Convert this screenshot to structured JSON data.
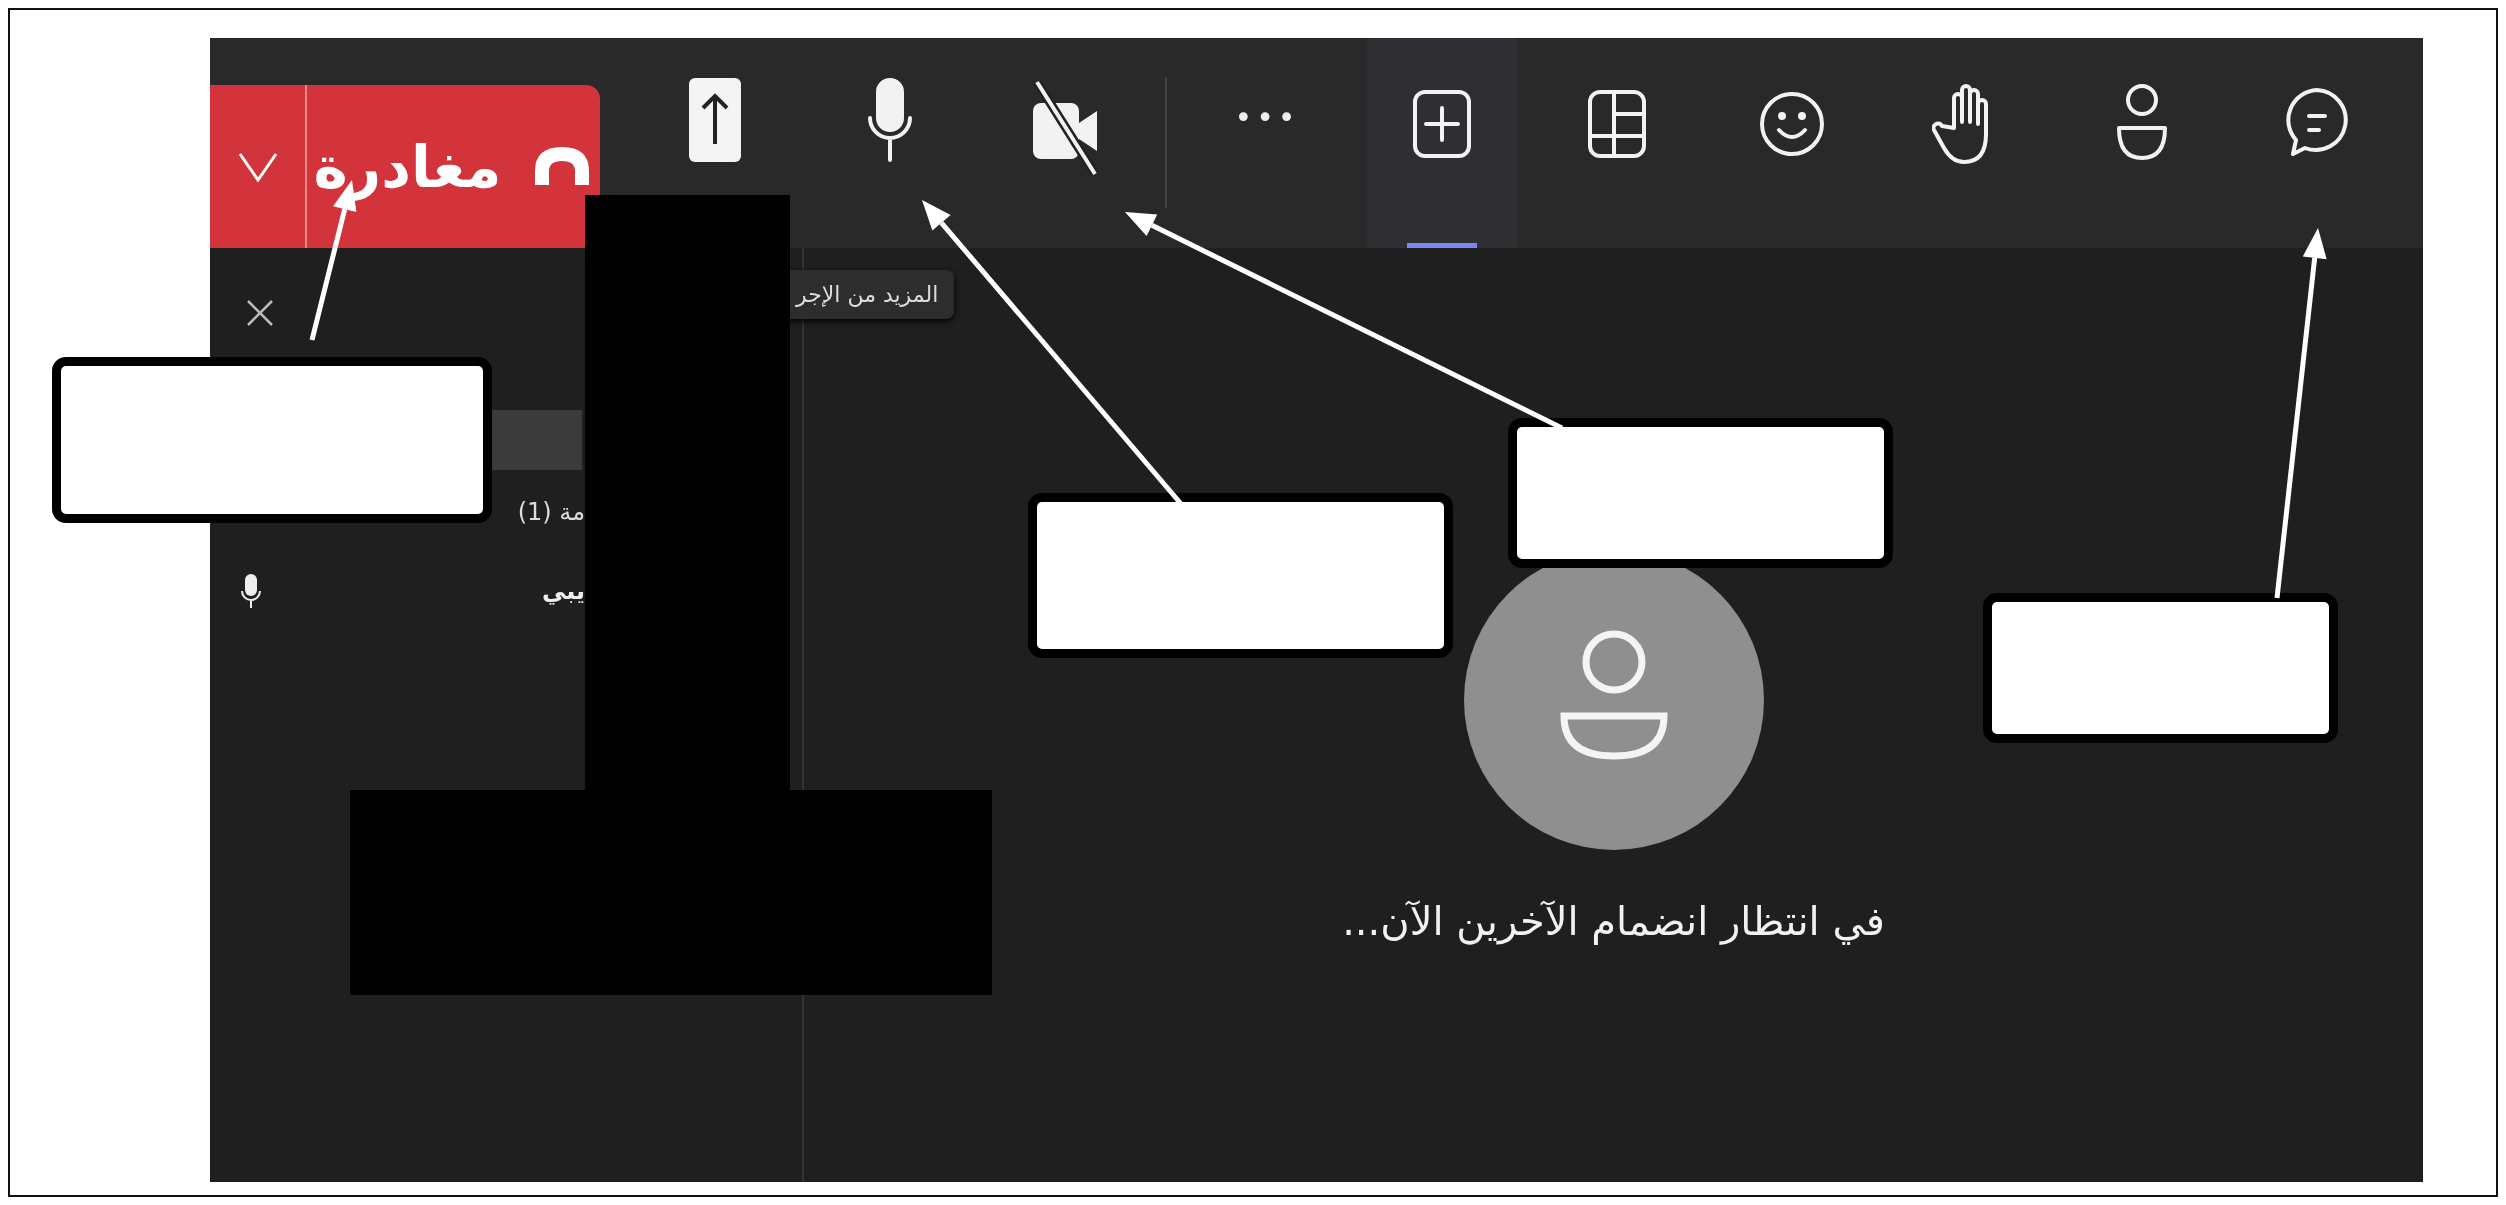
{
  "toolbar": {
    "leave_button": {
      "label": "مغادرة"
    },
    "items": [
      {
        "kind": "share",
        "selected": false
      },
      {
        "kind": "mic",
        "on": true
      },
      {
        "kind": "camera",
        "on": false
      },
      {
        "kind": "divider"
      },
      {
        "kind": "more",
        "label": "•••",
        "selected": false
      },
      {
        "kind": "apps",
        "selected": true
      },
      {
        "kind": "view",
        "selected": false
      },
      {
        "kind": "reactions",
        "selected": false
      },
      {
        "kind": "hand",
        "selected": false
      },
      {
        "kind": "people",
        "selected": false
      },
      {
        "kind": "chat",
        "selected": false
      }
    ]
  },
  "tooltip": "المزيد من الإجر",
  "side_panel": {
    "section_header": "مة (1)",
    "participants": [
      {
        "name": "يبي",
        "mic_on": true
      }
    ]
  },
  "stage": {
    "message": "في انتظار انضمام الآخرين الآن..."
  }
}
